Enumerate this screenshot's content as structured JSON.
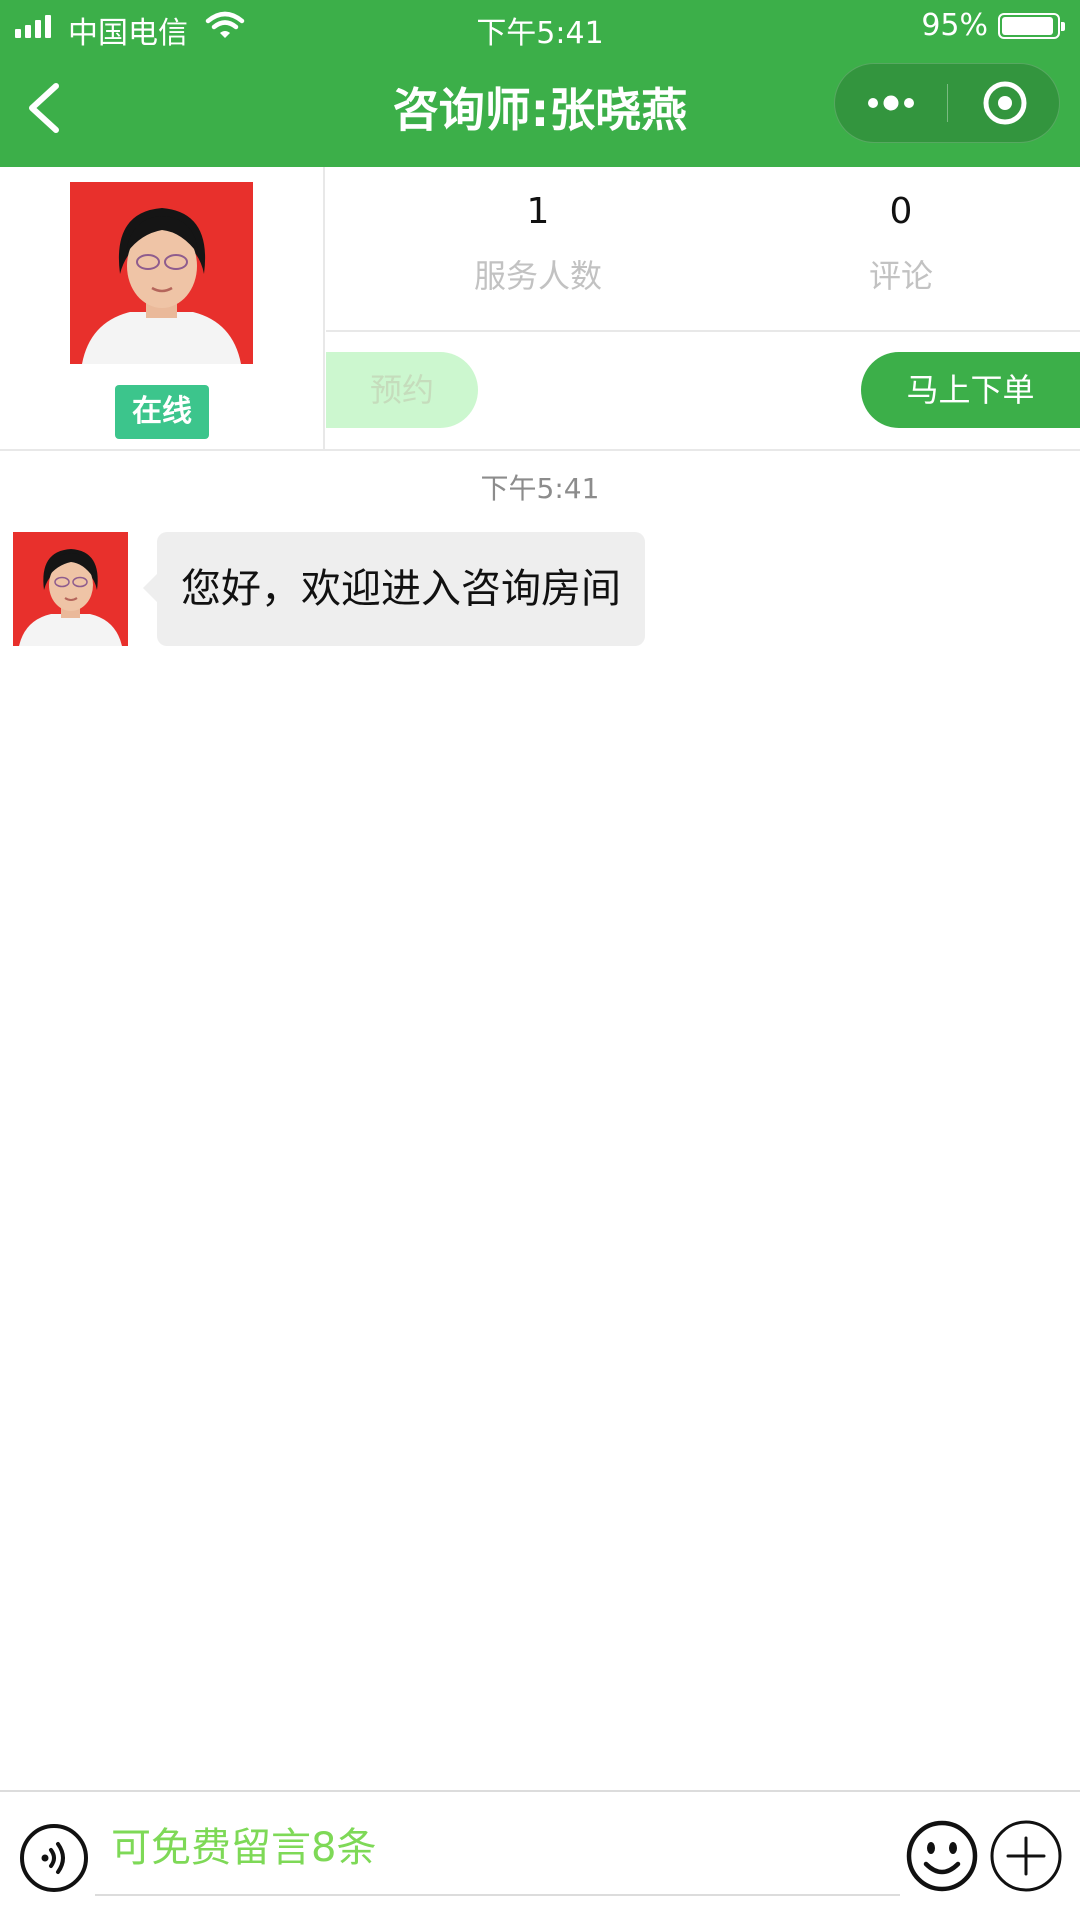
{
  "status_bar": {
    "carrier": "中国电信",
    "time": "下午5:41",
    "battery_percent": "95%",
    "battery_level": 0.95
  },
  "nav": {
    "title": "咨询师:张晓燕"
  },
  "profile": {
    "online_label": "在线",
    "stats": [
      {
        "value": "1",
        "label": "服务人数"
      },
      {
        "value": "0",
        "label": "评论"
      }
    ],
    "reserve_button": "预约",
    "order_button": "马上下单"
  },
  "chat": {
    "timestamp": "下午5:41",
    "messages": [
      {
        "text": "您好，欢迎进入咨询房间"
      }
    ]
  },
  "input_bar": {
    "placeholder": "可免费留言8条"
  },
  "colors": {
    "brand_green": "#3caf49",
    "online_badge": "#3cc58c",
    "placeholder_green": "#7ed957"
  }
}
